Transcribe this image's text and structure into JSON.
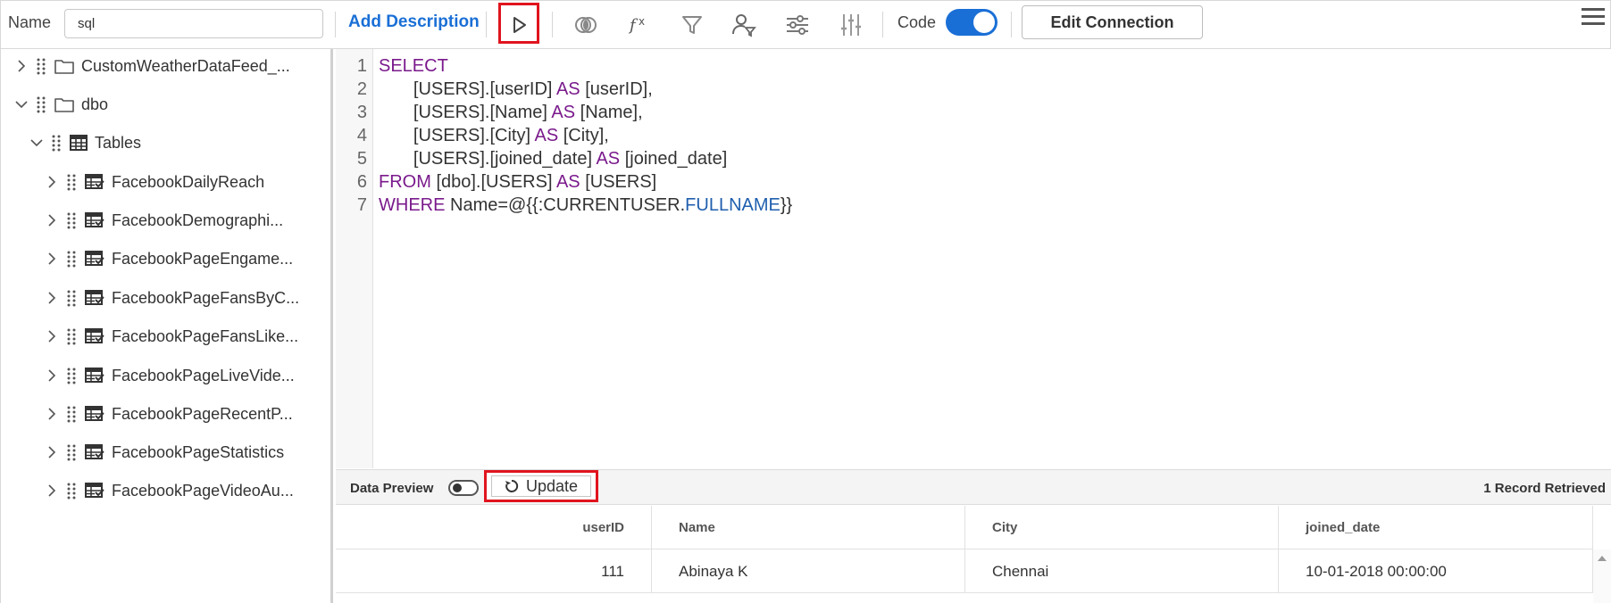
{
  "toolbar": {
    "name_label": "Name",
    "name_value": "sql",
    "add_description": "Add Description",
    "code_label": "Code",
    "code_toggle_on": true,
    "edit_connection": "Edit Connection",
    "icons": [
      "play-icon",
      "join-icon",
      "function-icon",
      "filter-icon",
      "user-filter-icon",
      "settings-sliders-icon",
      "column-sliders-icon",
      "hamburger-menu-icon"
    ]
  },
  "tree": {
    "items": [
      {
        "label": "CustomWeatherDataFeed_...",
        "level": 0,
        "expanded": false,
        "icon": "folder-icon"
      },
      {
        "label": "dbo",
        "level": 0,
        "expanded": true,
        "icon": "folder-icon"
      },
      {
        "label": "Tables",
        "level": 1,
        "expanded": true,
        "icon": "table-group-icon"
      },
      {
        "label": "FacebookDailyReach",
        "level": 2,
        "expanded": false,
        "icon": "table-icon"
      },
      {
        "label": "FacebookDemographi...",
        "level": 2,
        "expanded": false,
        "icon": "table-icon"
      },
      {
        "label": "FacebookPageEngame...",
        "level": 2,
        "expanded": false,
        "icon": "table-icon"
      },
      {
        "label": "FacebookPageFansByC...",
        "level": 2,
        "expanded": false,
        "icon": "table-icon"
      },
      {
        "label": "FacebookPageFansLike...",
        "level": 2,
        "expanded": false,
        "icon": "table-icon"
      },
      {
        "label": "FacebookPageLiveVide...",
        "level": 2,
        "expanded": false,
        "icon": "table-icon"
      },
      {
        "label": "FacebookPageRecentP...",
        "level": 2,
        "expanded": false,
        "icon": "table-icon"
      },
      {
        "label": "FacebookPageStatistics",
        "level": 2,
        "expanded": false,
        "icon": "table-icon"
      },
      {
        "label": "FacebookPageVideoAu...",
        "level": 2,
        "expanded": false,
        "icon": "table-icon"
      }
    ]
  },
  "editor": {
    "line_numbers": [
      "1",
      "2",
      "3",
      "4",
      "5",
      "6",
      "7"
    ],
    "lines": [
      [
        {
          "t": "SELECT",
          "c": "kw"
        }
      ],
      [
        {
          "t": "       [USERS].[userID] ",
          "c": ""
        },
        {
          "t": "AS",
          "c": "kw"
        },
        {
          "t": " [userID],",
          "c": ""
        }
      ],
      [
        {
          "t": "       [USERS].[Name] ",
          "c": ""
        },
        {
          "t": "AS",
          "c": "kw"
        },
        {
          "t": " [Name],",
          "c": ""
        }
      ],
      [
        {
          "t": "       [USERS].[City] ",
          "c": ""
        },
        {
          "t": "AS",
          "c": "kw"
        },
        {
          "t": " [City],",
          "c": ""
        }
      ],
      [
        {
          "t": "       [USERS].[joined_date] ",
          "c": ""
        },
        {
          "t": "AS",
          "c": "kw"
        },
        {
          "t": " [joined_date]",
          "c": ""
        }
      ],
      [
        {
          "t": "FROM",
          "c": "kw"
        },
        {
          "t": " [dbo].[USERS] ",
          "c": ""
        },
        {
          "t": "AS",
          "c": "kw"
        },
        {
          "t": " [USERS]",
          "c": ""
        }
      ],
      [
        {
          "t": "WHERE",
          "c": "kw"
        },
        {
          "t": " Name=@{{:CURRENTUSER.",
          "c": ""
        },
        {
          "t": "FULLNAME",
          "c": "fld"
        },
        {
          "t": "}}",
          "c": ""
        }
      ]
    ]
  },
  "preview": {
    "label": "Data Preview",
    "toggle_on": false,
    "update_label": "Update",
    "records": "1 Record Retrieved"
  },
  "results": {
    "columns": [
      "userID",
      "Name",
      "City",
      "joined_date"
    ],
    "rows": [
      [
        "111",
        "Abinaya K",
        "Chennai",
        "10-01-2018 00:00:00"
      ]
    ]
  }
}
